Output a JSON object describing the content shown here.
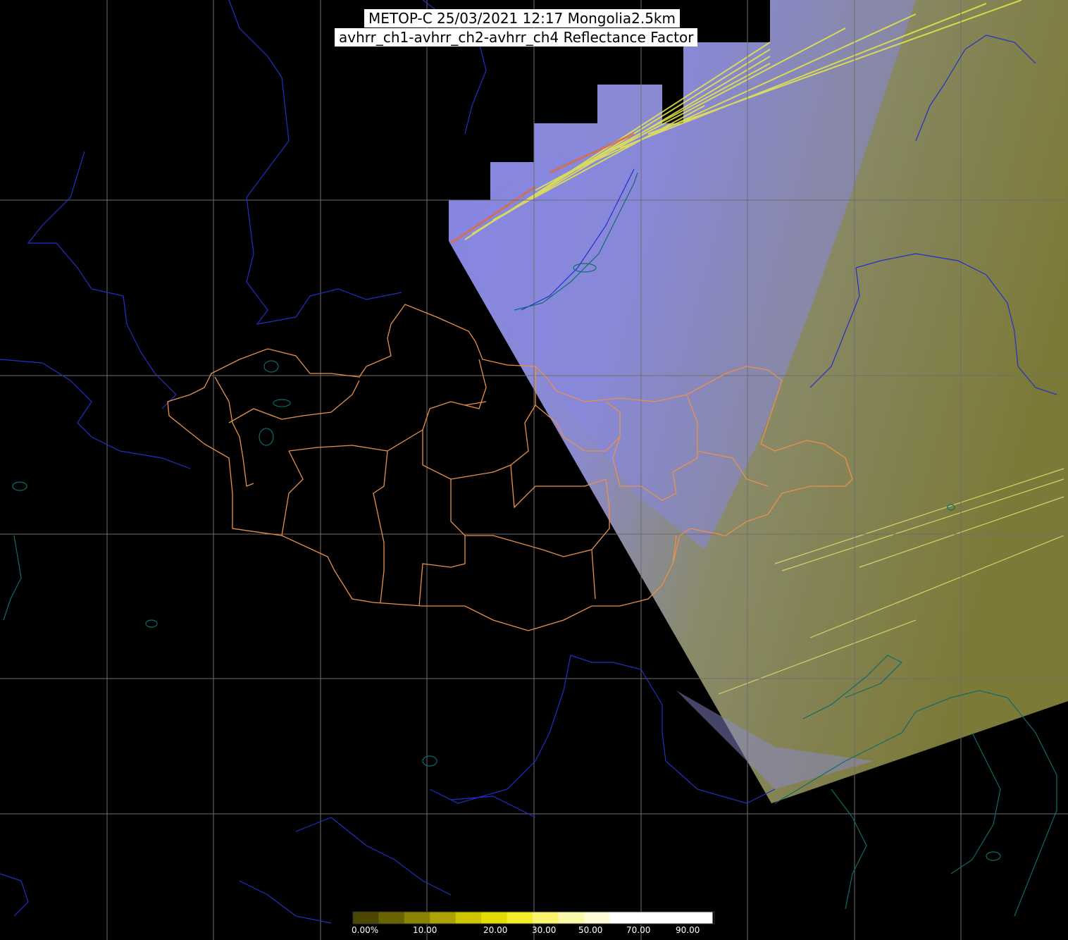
{
  "title": {
    "line1": "METOP-C 25/03/2021 12:17 Mongolia2.5km",
    "line2": "avhrr_ch1-avhrr_ch2-avhrr_ch4 Reflectance Factor"
  },
  "colorbar": {
    "ticks": [
      "0.00%",
      "10.00",
      "20.00",
      "30.00",
      "50.00",
      "70.00",
      "90.00"
    ],
    "colors": [
      "#4d4700",
      "#6b6500",
      "#8a8400",
      "#aca300",
      "#cdc500",
      "#e4dc00",
      "#f3ee2a",
      "#f8f46e",
      "#fbf8a8",
      "#fdfcd6",
      "#ffffff",
      "#ffffff",
      "#ffffff",
      "#ffffff"
    ]
  },
  "colors": {
    "background": "#000000",
    "grid": "#6e6e6e",
    "rivers": "#1f30c8",
    "coastline": "#0f6b6b",
    "admin_borders": "#e9914a",
    "swath_clear": "#7d7d3c",
    "swath_cloud": "#7f7fe6"
  }
}
